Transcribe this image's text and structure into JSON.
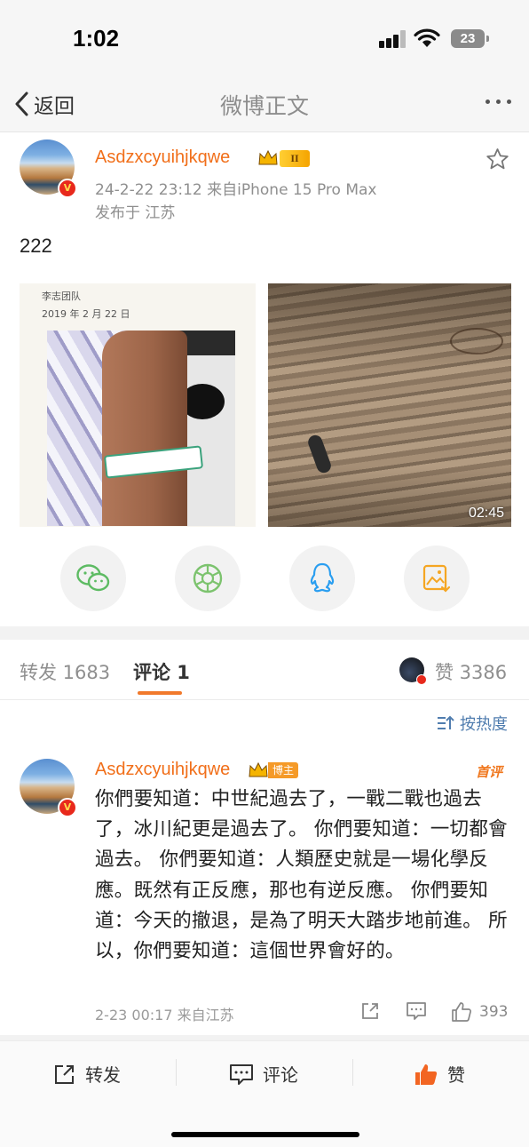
{
  "status": {
    "time": "1:02",
    "battery": "23"
  },
  "nav": {
    "back_label": "返回",
    "title": "微博正文"
  },
  "post": {
    "author": "Asdzxcyuihjkqwe",
    "level_badge": "II",
    "verified": true,
    "meta": "24-2-22 23:12  来自iPhone 15 Pro Max",
    "location": "发布于 江苏",
    "text": "222",
    "image1": {
      "caption_team": "李志团队",
      "caption_date": "2019 年 2 月 22 日"
    },
    "image2": {
      "duration": "02:45"
    }
  },
  "share": [
    "wechat-icon",
    "moments-icon",
    "qq-icon",
    "save-image-icon"
  ],
  "tabs": {
    "repost": "转发 1683",
    "comments": "评论 1",
    "likes": "赞 3386"
  },
  "sort": {
    "label": "按热度"
  },
  "comment": {
    "author": "Asdzxcyuihjkqwe",
    "owner_badge": "博主",
    "first_badge": "首评",
    "text": "你們要知道：中世紀過去了，一戰二戰也過去了，冰川紀更是過去了。 你們要知道：一切都會過去。 你們要知道：人類歷史就是一場化學反應。既然有正反應，那也有逆反應。 你們要知道：今天的撤退，是為了明天大踏步地前進。 所以，你們要知道：這個世界會好的。",
    "meta": "2-23 00:17 来自江苏",
    "likes": "393"
  },
  "bottom": {
    "repost": "转发",
    "comment": "评论",
    "like": "赞"
  },
  "colors": {
    "accent": "#f16f1a",
    "link": "#507daf",
    "muted": "#8f8f8f"
  }
}
